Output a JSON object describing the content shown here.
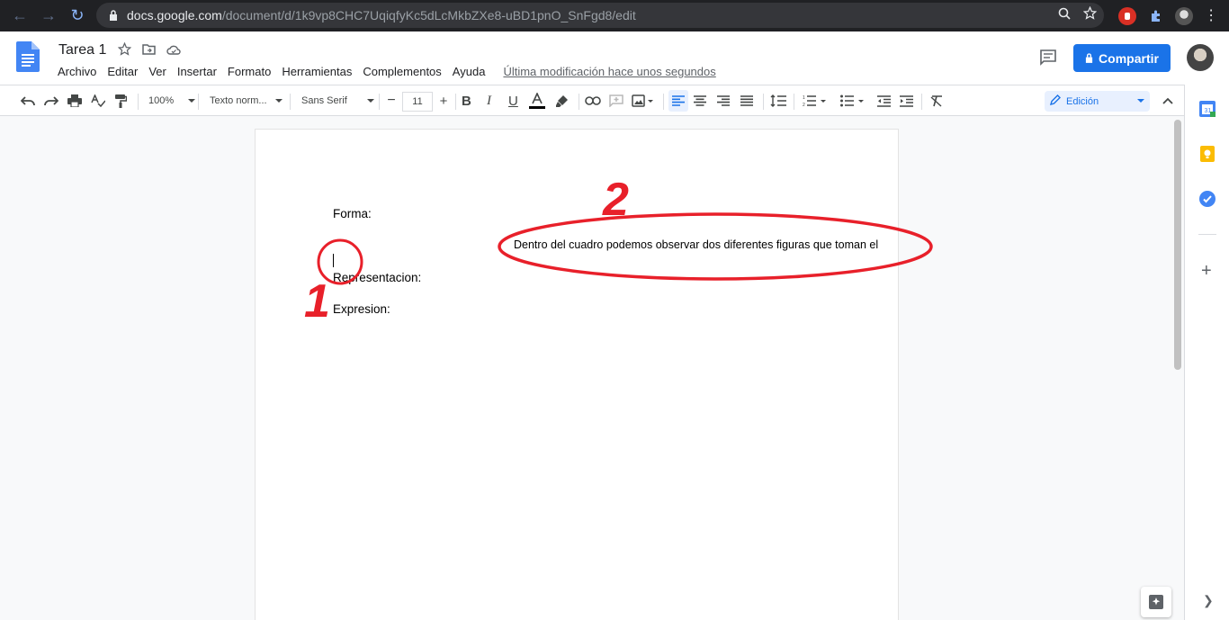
{
  "browser": {
    "url_host": "docs.google.com",
    "url_path": "/document/d/1k9vp8CHC7UqiqfyKc5dLcMkbZXe8-uBD1pnO_SnFgd8/edit"
  },
  "header": {
    "title": "Tarea 1",
    "menu": [
      "Archivo",
      "Editar",
      "Ver",
      "Insertar",
      "Formato",
      "Herramientas",
      "Complementos",
      "Ayuda"
    ],
    "last_modified": "Última modificación hace unos segundos",
    "share_label": "Compartir"
  },
  "toolbar": {
    "zoom": "100%",
    "style": "Texto norm...",
    "font": "Sans Serif",
    "font_size": "11",
    "mode": "Edición"
  },
  "document": {
    "lines": [
      "Forma:",
      "Representacion:",
      "Expresion:"
    ],
    "floating_text": "Dentro del cuadro podemos observar dos diferentes figuras que toman el"
  },
  "annotations": {
    "label_1": "1",
    "label_2": "2"
  },
  "colors": {
    "accent": "#1a73e8",
    "annotation": "#e8202a"
  }
}
